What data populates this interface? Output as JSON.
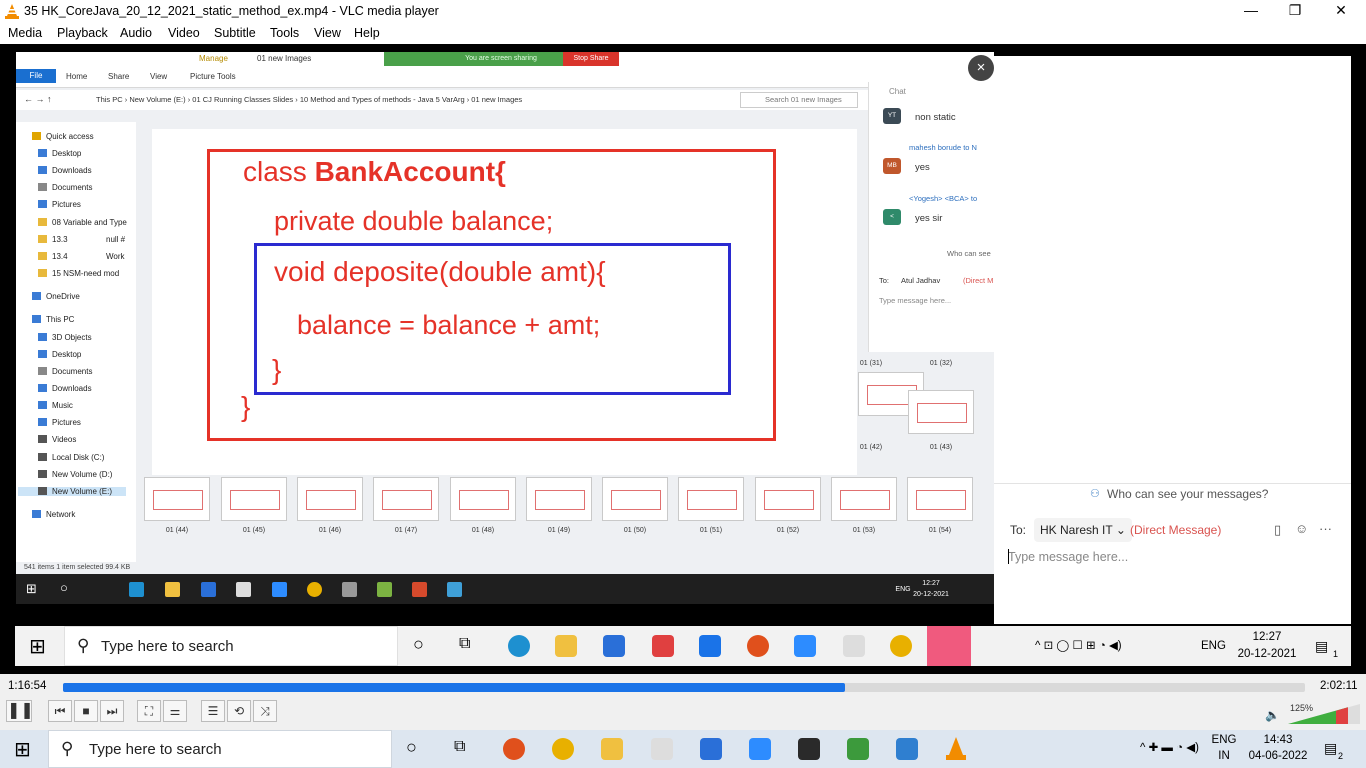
{
  "window": {
    "title": "35 HK_CoreJava_20_12_2021_static_method_ex.mp4 - VLC media player",
    "minimize": "—",
    "maximize": "❐",
    "close": "✕"
  },
  "menu": [
    "Media",
    "Playback",
    "Audio",
    "Video",
    "Subtitle",
    "Tools",
    "View",
    "Help"
  ],
  "remote": {
    "ribbon_tabs": [
      "File",
      "Home",
      "Share",
      "View",
      "Picture Tools"
    ],
    "manage_label": "Manage",
    "folder_label": "01 new Images",
    "sharing_banner": "You are screen sharing",
    "stop_share": "Stop Share",
    "address_path": "This PC  ›  New Volume (E:)  ›  01 CJ Running Classes Slides  ›  10 Method and Types of methods - Java 5 VarArg  ›  01 new Images",
    "search_placeholder": "Search 01 new Images",
    "nav_items": [
      "Quick access",
      "Desktop",
      "Downloads",
      "Documents",
      "Pictures",
      "08 Variable and Type",
      "13.3",
      "13.4",
      "15 NSM-need mod",
      "OneDrive",
      "This PC",
      "3D Objects",
      "Desktop",
      "Documents",
      "Downloads",
      "Music",
      "Pictures",
      "Videos",
      "Local Disk (C:)",
      "New Volume (D:)",
      "New Volume (E:)",
      "Network"
    ],
    "nav_extra": [
      "null #",
      "Work"
    ],
    "thumb_labels": [
      "01 (44)",
      "01 (45)",
      "01 (46)",
      "01 (47)",
      "01 (48)",
      "01 (49)",
      "01 (50)",
      "01 (51)",
      "01 (52)",
      "01 (53)",
      "01 (54)"
    ],
    "side_thumb_labels": [
      "01 (31)",
      "01 (32)",
      "01 (42)",
      "01 (43)"
    ],
    "status": "541 items      1 item selected  99.4 KB",
    "chat": {
      "header": "Chat",
      "messages": [
        {
          "initials": "YT",
          "sender": "",
          "text": "non static",
          "color": "#3b4a55"
        },
        {
          "initials": "MB",
          "sender": "mahesh borude to N",
          "text": "yes",
          "color": "#c0572c"
        },
        {
          "initials": "<",
          "sender": "<Yogesh> <BCA> to",
          "text": "yes sir",
          "color": "#2f8a6a"
        }
      ],
      "who": "Who can see",
      "to_label": "To:",
      "recipient": "Atul Jadhav",
      "dm": "(Direct M",
      "placeholder": "Type message here..."
    },
    "clock_time": "12:27",
    "clock_date": "20-12-2021",
    "lang": "ENG"
  },
  "slide": {
    "line1_prefix": "class ",
    "line1_bold": "BankAccount{",
    "line2": "private double balance;",
    "line3": "void deposite(double amt){",
    "line4": "balance = balance + amt;",
    "line5": "}",
    "line6": "}"
  },
  "zoom_panel": {
    "who_can_see": "Who can see your messages?",
    "to_label": "To:",
    "recipient": "HK Naresh IT",
    "direct_message": "(Direct Message)",
    "placeholder": "Type message here..."
  },
  "mid_taskbar": {
    "search_placeholder": "Type here to search",
    "lang": "ENG",
    "time": "12:27",
    "date": "20-12-2021",
    "notif_count": "1"
  },
  "player": {
    "elapsed": "1:16:54",
    "total": "2:02:11",
    "progress": 0.63,
    "volume_percent": "125%",
    "buttons": [
      "pause",
      "prev",
      "stop",
      "next",
      "fullscreen",
      "extended-settings",
      "playlist",
      "loop",
      "shuffle"
    ]
  },
  "host_taskbar": {
    "search_placeholder": "Type here to search",
    "lang_top": "ENG",
    "lang_bottom": "IN",
    "time": "14:43",
    "date": "04-06-2022",
    "notif_count": "2"
  }
}
